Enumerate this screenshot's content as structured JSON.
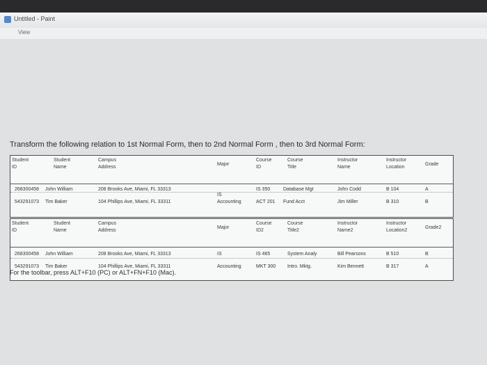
{
  "window": {
    "title": "Untitled - Paint",
    "view_tab": "View"
  },
  "heading": "Transform the following relation to 1st Normal Form, then to 2nd Normal Form , then to 3rd Normal Form:",
  "table1": {
    "headers": [
      [
        "Student",
        "ID"
      ],
      [
        "Student",
        "Name"
      ],
      [
        "Campus",
        "Address"
      ],
      [
        "Major",
        ""
      ],
      [
        "Course",
        "ID"
      ],
      [
        "Course",
        "Title"
      ],
      [
        "Instructor",
        "Name"
      ],
      [
        "Instructor",
        "Location"
      ],
      [
        "Grade",
        ""
      ]
    ],
    "rows": [
      [
        "268300458",
        "John William",
        "208 Brooks Ave, Miami, FL 33313",
        "",
        "IS 350",
        "Database Mgt",
        "John Codd",
        "B 104",
        "A"
      ],
      [
        "543291073",
        "Tim Baker",
        "104 Phillips Ave, Miami, FL 33311",
        "IS",
        "ACT 201",
        "Fund Acct",
        "Jim Miller",
        "B 310",
        "B"
      ]
    ],
    "major_row1": "IS",
    "major_row2": "Accounting"
  },
  "table2": {
    "headers": [
      [
        "Student",
        "ID"
      ],
      [
        "Student",
        "Name"
      ],
      [
        "Campus",
        "Address"
      ],
      [
        "Major",
        ""
      ],
      [
        "Course",
        "ID2"
      ],
      [
        "Course",
        "Title2"
      ],
      [
        "Instructor",
        "Name2"
      ],
      [
        "Instructor",
        "Location2"
      ],
      [
        "Grade2",
        ""
      ]
    ],
    "rows": [
      [
        "268300458",
        "John William",
        "208 Brooks Ave, Miami, FL 33313",
        "IS",
        "IS 465",
        "System Analy",
        "Bill Pearsons",
        "B 510",
        "B"
      ],
      [
        "543291073",
        "Tim Baker",
        "104 Phillips Ave, Miami, FL 33311",
        "Accounting",
        "MKT 300",
        "Intro. Mktg.",
        "Kim Bennett",
        "B 317",
        "A"
      ]
    ]
  },
  "footer": "For the toolbar, press ALT+F10 (PC) or ALT+FN+F10 (Mac)."
}
